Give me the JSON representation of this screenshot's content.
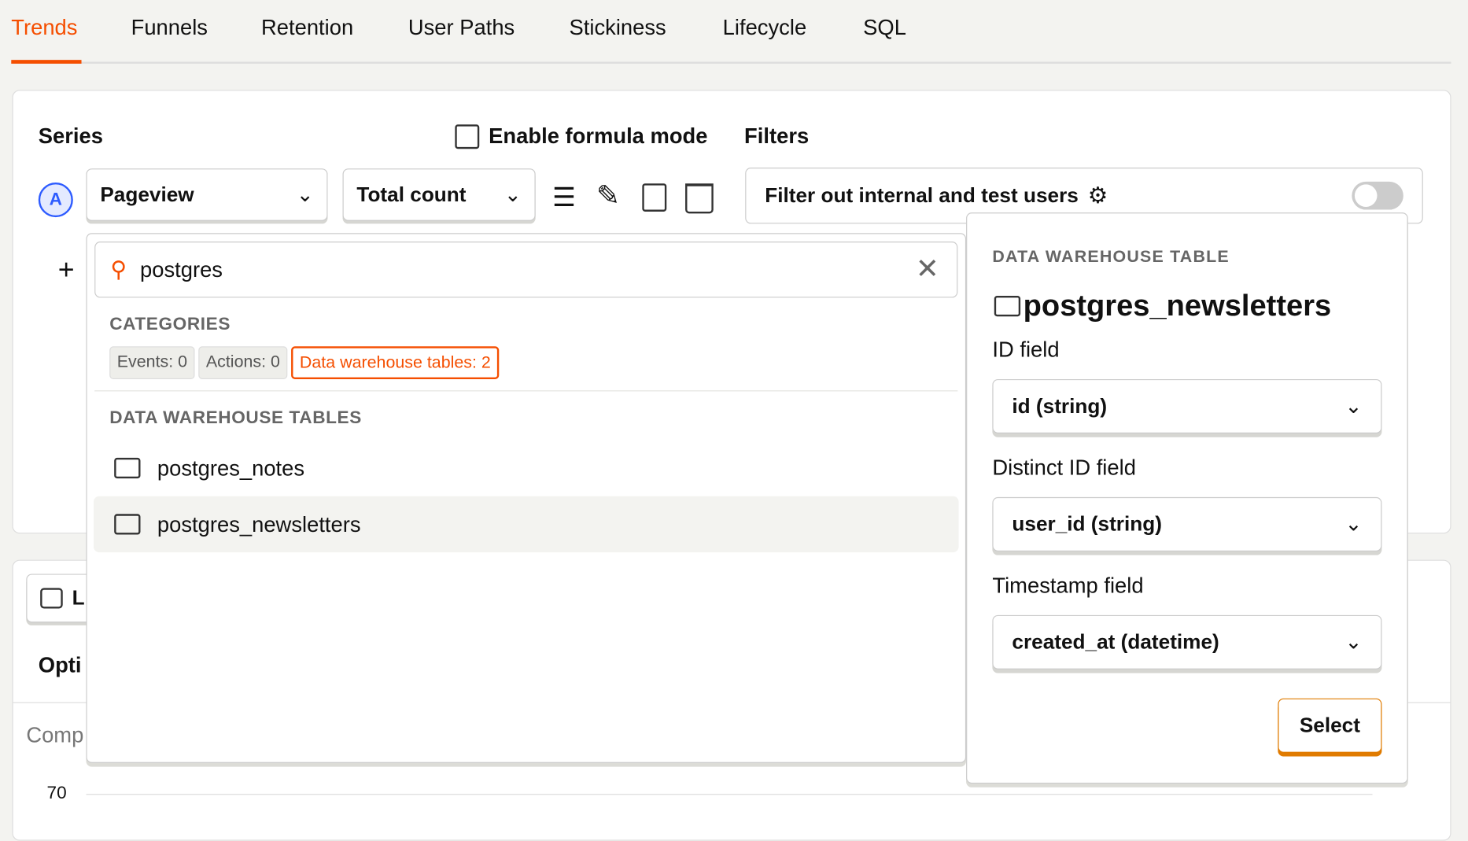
{
  "tabs": [
    {
      "label": "Trends",
      "active": true
    },
    {
      "label": "Funnels"
    },
    {
      "label": "Retention"
    },
    {
      "label": "User Paths"
    },
    {
      "label": "Stickiness"
    },
    {
      "label": "Lifecycle"
    },
    {
      "label": "SQL"
    }
  ],
  "series": {
    "title": "Series",
    "formula_label": "Enable formula mode",
    "letter": "A",
    "event": "Pageview",
    "math": "Total count"
  },
  "filters": {
    "title": "Filters",
    "internal_label": "Filter out internal and test users",
    "toggle_on": false
  },
  "search": {
    "value": "postgres",
    "categories_title": "CATEGORIES",
    "chips": [
      "Events: 0",
      "Actions: 0",
      "Data warehouse tables: 2"
    ],
    "section_title": "DATA WAREHOUSE TABLES",
    "items": [
      "postgres_notes",
      "postgres_newsletters"
    ]
  },
  "background": {
    "date_label": "L",
    "options_label": "Opti",
    "compare_label": "Comp",
    "y_tick": "70"
  },
  "warehouse": {
    "heading": "DATA WAREHOUSE TABLE",
    "table": "postgres_newsletters",
    "id_label": "ID field",
    "id_value": "id (string)",
    "distinct_label": "Distinct ID field",
    "distinct_value": "user_id (string)",
    "timestamp_label": "Timestamp field",
    "timestamp_value": "created_at (datetime)",
    "select_label": "Select"
  },
  "colors": {
    "accent": "#f54e00",
    "series_blue": "#2d5bff"
  }
}
